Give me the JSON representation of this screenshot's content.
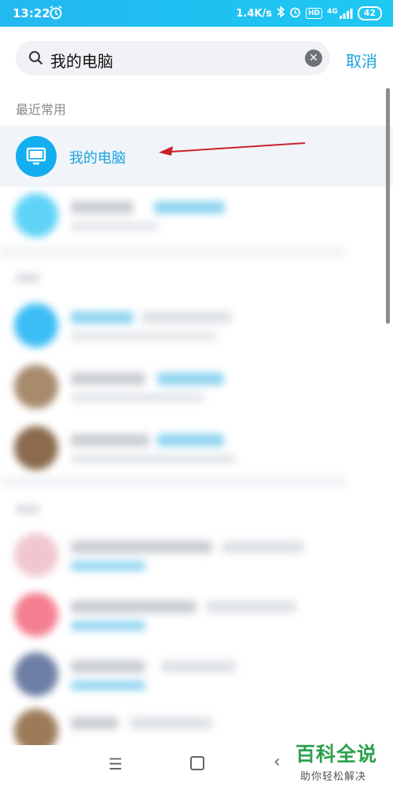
{
  "status_bar": {
    "time": "13:22",
    "network_speed": "1.4K/s",
    "network_type": "4G",
    "hd_badge": "HD",
    "battery": "42"
  },
  "search": {
    "query": "我的电脑",
    "cancel_label": "取消"
  },
  "recent": {
    "section_label": "最近常用",
    "highlighted_item": {
      "name": "我的电脑",
      "icon": "monitor-icon",
      "avatar_color": "#12aef0"
    }
  },
  "annotation": {
    "type": "red-arrow",
    "color": "#c8222a"
  },
  "colors": {
    "accent": "#1aa3de",
    "statusbar": "#22b8f0",
    "watermark_green": "#2aa14b"
  },
  "watermark": {
    "title": "百科全说",
    "subtitle": "助你轻松解决"
  },
  "nav_bar": {
    "icons": [
      "menu-icon",
      "home-icon",
      "back-icon"
    ]
  }
}
